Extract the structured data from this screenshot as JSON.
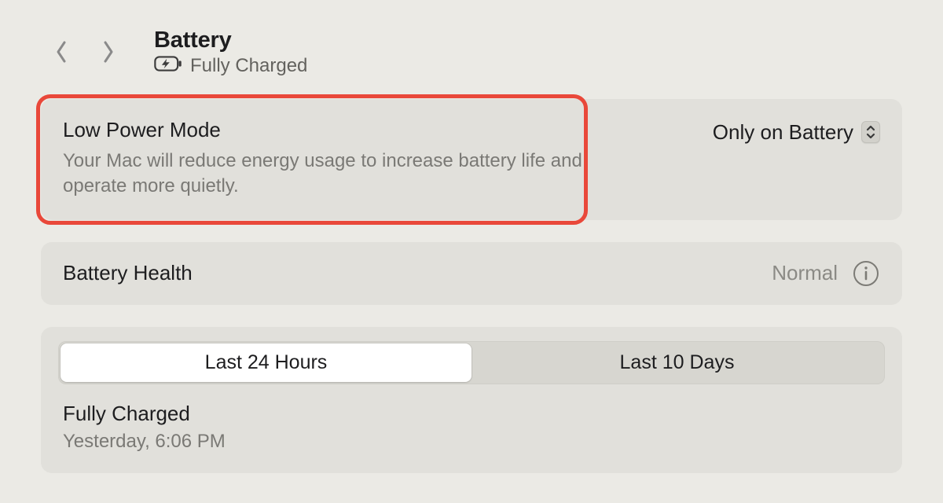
{
  "header": {
    "title": "Battery",
    "subtitle": "Fully Charged"
  },
  "low_power": {
    "title": "Low Power Mode",
    "description": "Your Mac will reduce energy usage to increase battery life and operate more quietly.",
    "selected_option": "Only on Battery"
  },
  "battery_health": {
    "label": "Battery Health",
    "value": "Normal"
  },
  "segments": {
    "a": "Last 24 Hours",
    "b": "Last 10 Days",
    "active_index": 0
  },
  "charge_status": {
    "title": "Fully Charged",
    "timestamp": "Yesterday, 6:06 PM"
  }
}
